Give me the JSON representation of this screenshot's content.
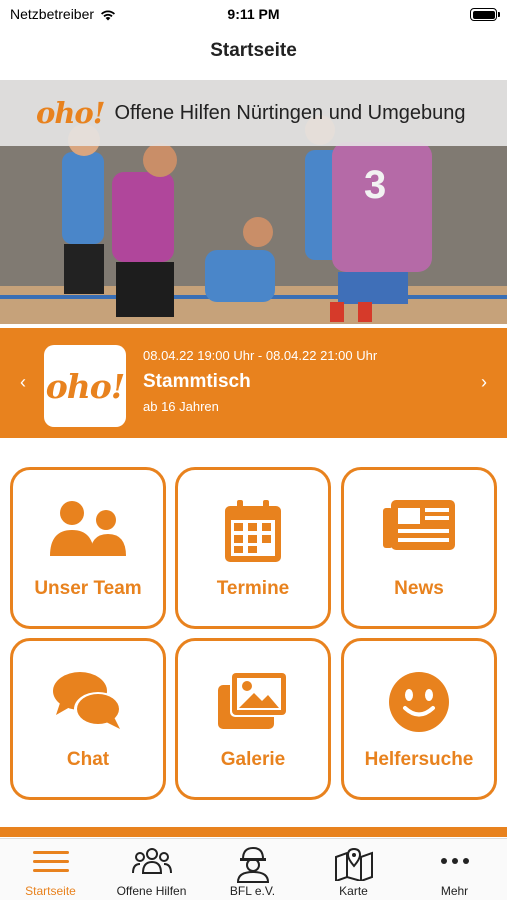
{
  "status_bar": {
    "carrier": "Netzbetreiber",
    "time": "9:11 PM"
  },
  "nav": {
    "title": "Startseite"
  },
  "hero": {
    "logo_text": "oho!",
    "title": "Offene Hilfen Nürtingen und Umgebung"
  },
  "event": {
    "logo_text": "oho!",
    "date_range": "08.04.22 19:00 Uhr - 08.04.22 21:00 Uhr",
    "name": "Stammtisch",
    "age": "ab 16 Jahren",
    "prev_icon": "‹",
    "next_icon": "›"
  },
  "tiles": [
    {
      "label": "Unser Team",
      "icon": "team-icon"
    },
    {
      "label": "Termine",
      "icon": "calendar-icon"
    },
    {
      "label": "News",
      "icon": "newspaper-icon"
    },
    {
      "label": "Chat",
      "icon": "chat-icon"
    },
    {
      "label": "Galerie",
      "icon": "gallery-icon"
    },
    {
      "label": "Helfersuche",
      "icon": "smiley-icon"
    }
  ],
  "tabs": [
    {
      "label": "Startseite",
      "icon": "menu-icon",
      "active": true
    },
    {
      "label": "Offene Hilfen",
      "icon": "group-icon",
      "active": false
    },
    {
      "label": "BFL e.V.",
      "icon": "worker-icon",
      "active": false
    },
    {
      "label": "Karte",
      "icon": "map-icon",
      "active": false
    },
    {
      "label": "Mehr",
      "icon": "more-icon",
      "active": false
    }
  ],
  "colors": {
    "accent": "#e8821e",
    "text": "#222222",
    "background": "#ffffff"
  }
}
